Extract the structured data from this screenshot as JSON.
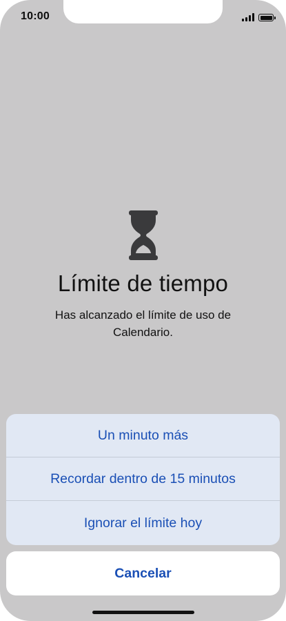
{
  "status_bar": {
    "time": "10:00",
    "signal_icon": "cellular-signal-icon",
    "battery_icon": "battery-icon"
  },
  "main": {
    "icon": "hourglass-icon",
    "title": "Límite de tiempo",
    "message": "Has alcanzado el límite de uso de Calendario."
  },
  "action_sheet": {
    "actions": [
      {
        "label": "Un minuto más"
      },
      {
        "label": "Recordar dentro de 15 minutos"
      },
      {
        "label": "Ignorar el límite hoy"
      }
    ],
    "cancel_label": "Cancelar"
  },
  "colors": {
    "background_dim": "#c9c8c9",
    "action_sheet_bg": "#e1e8f4",
    "action_text": "#1a4fb5",
    "icon": "#3a3a3c"
  }
}
